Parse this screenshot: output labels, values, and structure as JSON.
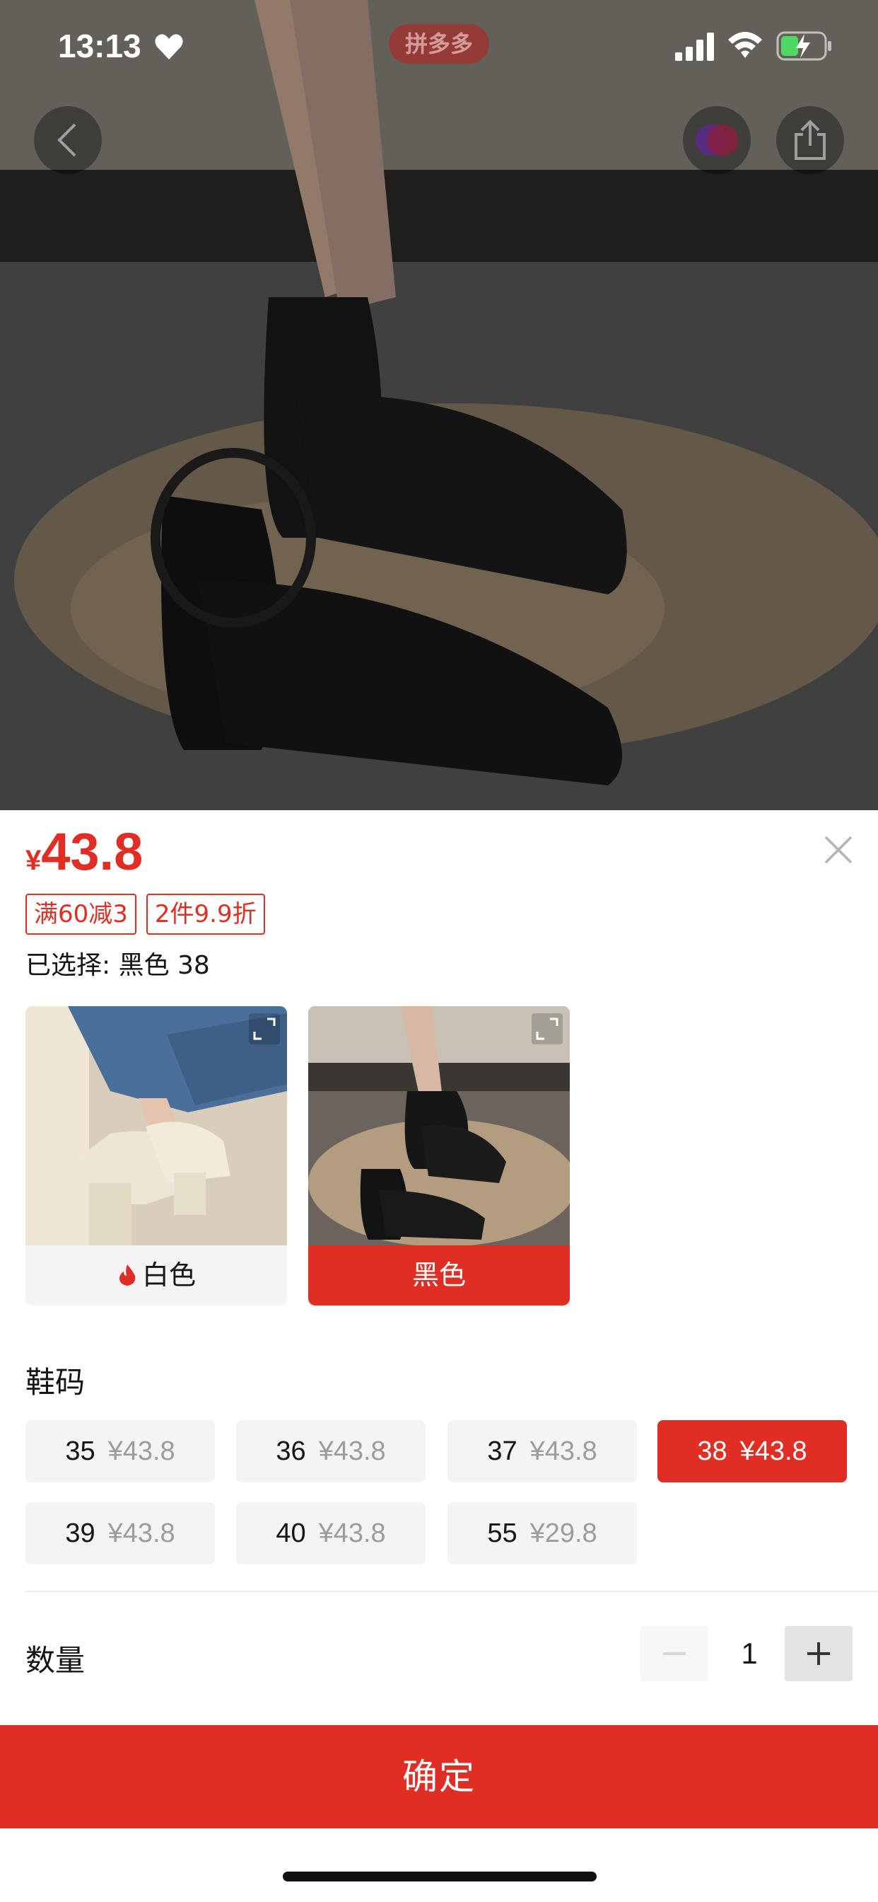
{
  "status_bar": {
    "time": "13:13",
    "app_badge": "拼多多",
    "icons": [
      "heart-icon",
      "signal-icon",
      "wifi-icon",
      "battery-charging-icon"
    ]
  },
  "top_actions": {
    "icons": [
      "back-icon",
      "coupon-icon",
      "share-icon"
    ]
  },
  "product": {
    "currency_symbol": "¥",
    "price": "43.8",
    "promos": [
      "满60减3",
      "2件9.9折"
    ],
    "selected_text": "已选择: 黑色 38"
  },
  "colors": [
    {
      "label": "白色",
      "hot": true,
      "selected": false
    },
    {
      "label": "黑色",
      "hot": false,
      "selected": true
    }
  ],
  "sizes": {
    "title": "鞋码",
    "options": [
      {
        "size": "35",
        "price": "¥43.8",
        "selected": false
      },
      {
        "size": "36",
        "price": "¥43.8",
        "selected": false
      },
      {
        "size": "37",
        "price": "¥43.8",
        "selected": false
      },
      {
        "size": "38",
        "price": "¥43.8",
        "selected": true
      },
      {
        "size": "39",
        "price": "¥43.8",
        "selected": false
      },
      {
        "size": "40",
        "price": "¥43.8",
        "selected": false
      },
      {
        "size": "55",
        "price": "¥29.8",
        "selected": false
      }
    ]
  },
  "quantity": {
    "label": "数量",
    "value": "1"
  },
  "confirm_label": "确定",
  "theme": {
    "accent": "#e02e24",
    "chip_bg": "#f4f4f4",
    "muted_text": "#9c9c9c"
  }
}
